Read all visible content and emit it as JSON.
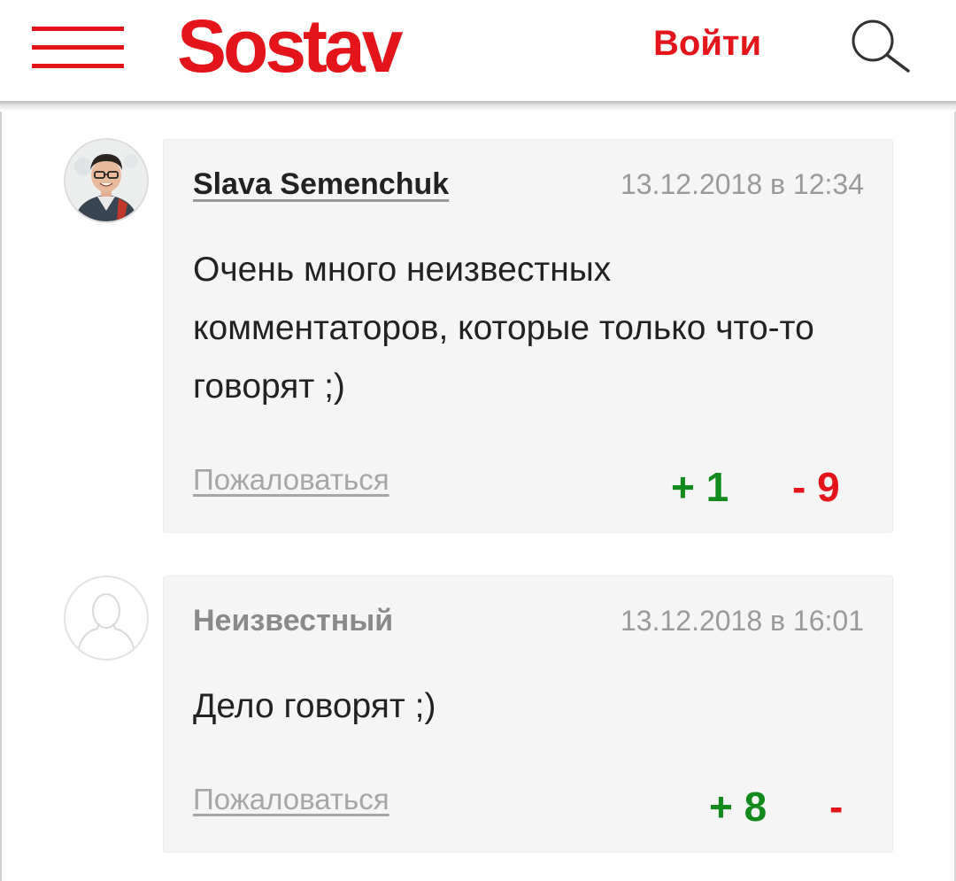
{
  "header": {
    "logo": "Sostav",
    "login_label": "Войти"
  },
  "icons": {
    "menu": "hamburger-menu-icon",
    "search": "search-icon",
    "user_placeholder": "user-silhouette-icon"
  },
  "colors": {
    "brand": "#e4141b",
    "vote_up": "#138a1c",
    "vote_down": "#e4141b"
  },
  "comments": [
    {
      "author": "Slava Semenchuk",
      "date": "13.12.2018 в 12:34",
      "text": "Очень много неизвестных комментаторов, которые только что-то говорят ;)",
      "complain": "Пожаловаться",
      "plus": "+ 1",
      "minus": "- 9"
    },
    {
      "author": "Неизвестный",
      "date": "13.12.2018 в 16:01",
      "text": "Дело говорят ;)",
      "complain": "Пожаловаться",
      "plus": "+ 8",
      "minus": "-"
    }
  ]
}
